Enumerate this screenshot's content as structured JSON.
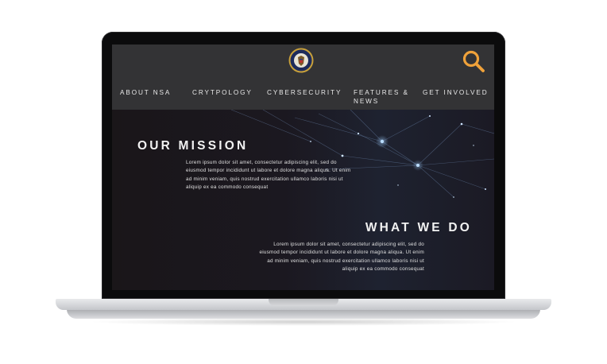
{
  "nav": {
    "items": [
      {
        "label": "ABOUT NSA"
      },
      {
        "label": "CRYTPOLOGY"
      },
      {
        "label": "CYBERSECURITY"
      },
      {
        "label": "FEATURES & NEWS"
      },
      {
        "label": "GET INVOLVED"
      }
    ]
  },
  "icons": {
    "logo": "nsa-seal-icon",
    "search": "search-icon"
  },
  "colors": {
    "header_bg": "#333335",
    "hero_bg": "#1a1619",
    "search_icon": "#f0a23a"
  },
  "mission": {
    "heading": "OUR MISSION",
    "lines": [
      "Lorem ipsum dolor sit amet, consectetur adipiscing elit, sed do",
      "eiusmod tempor incididunt ut labore et dolore magna aliqua. Ut enim",
      "ad minim veniam, quis nostrud exercitation ullamco laboris nisi ut",
      "aliquip ex ea commodo consequat"
    ]
  },
  "what": {
    "heading": "WHAT WE DO",
    "lines": [
      "Lorem ipsum dolor sit amet, consectetur adipiscing elit, sed do",
      "eiusmod tempor incididunt ut labore et dolore magna aliqua. Ut enim",
      "ad minim veniam, quis nostrud exercitation ullamco laboris nisi ut",
      "aliquip ex ea commodo consequat"
    ]
  }
}
